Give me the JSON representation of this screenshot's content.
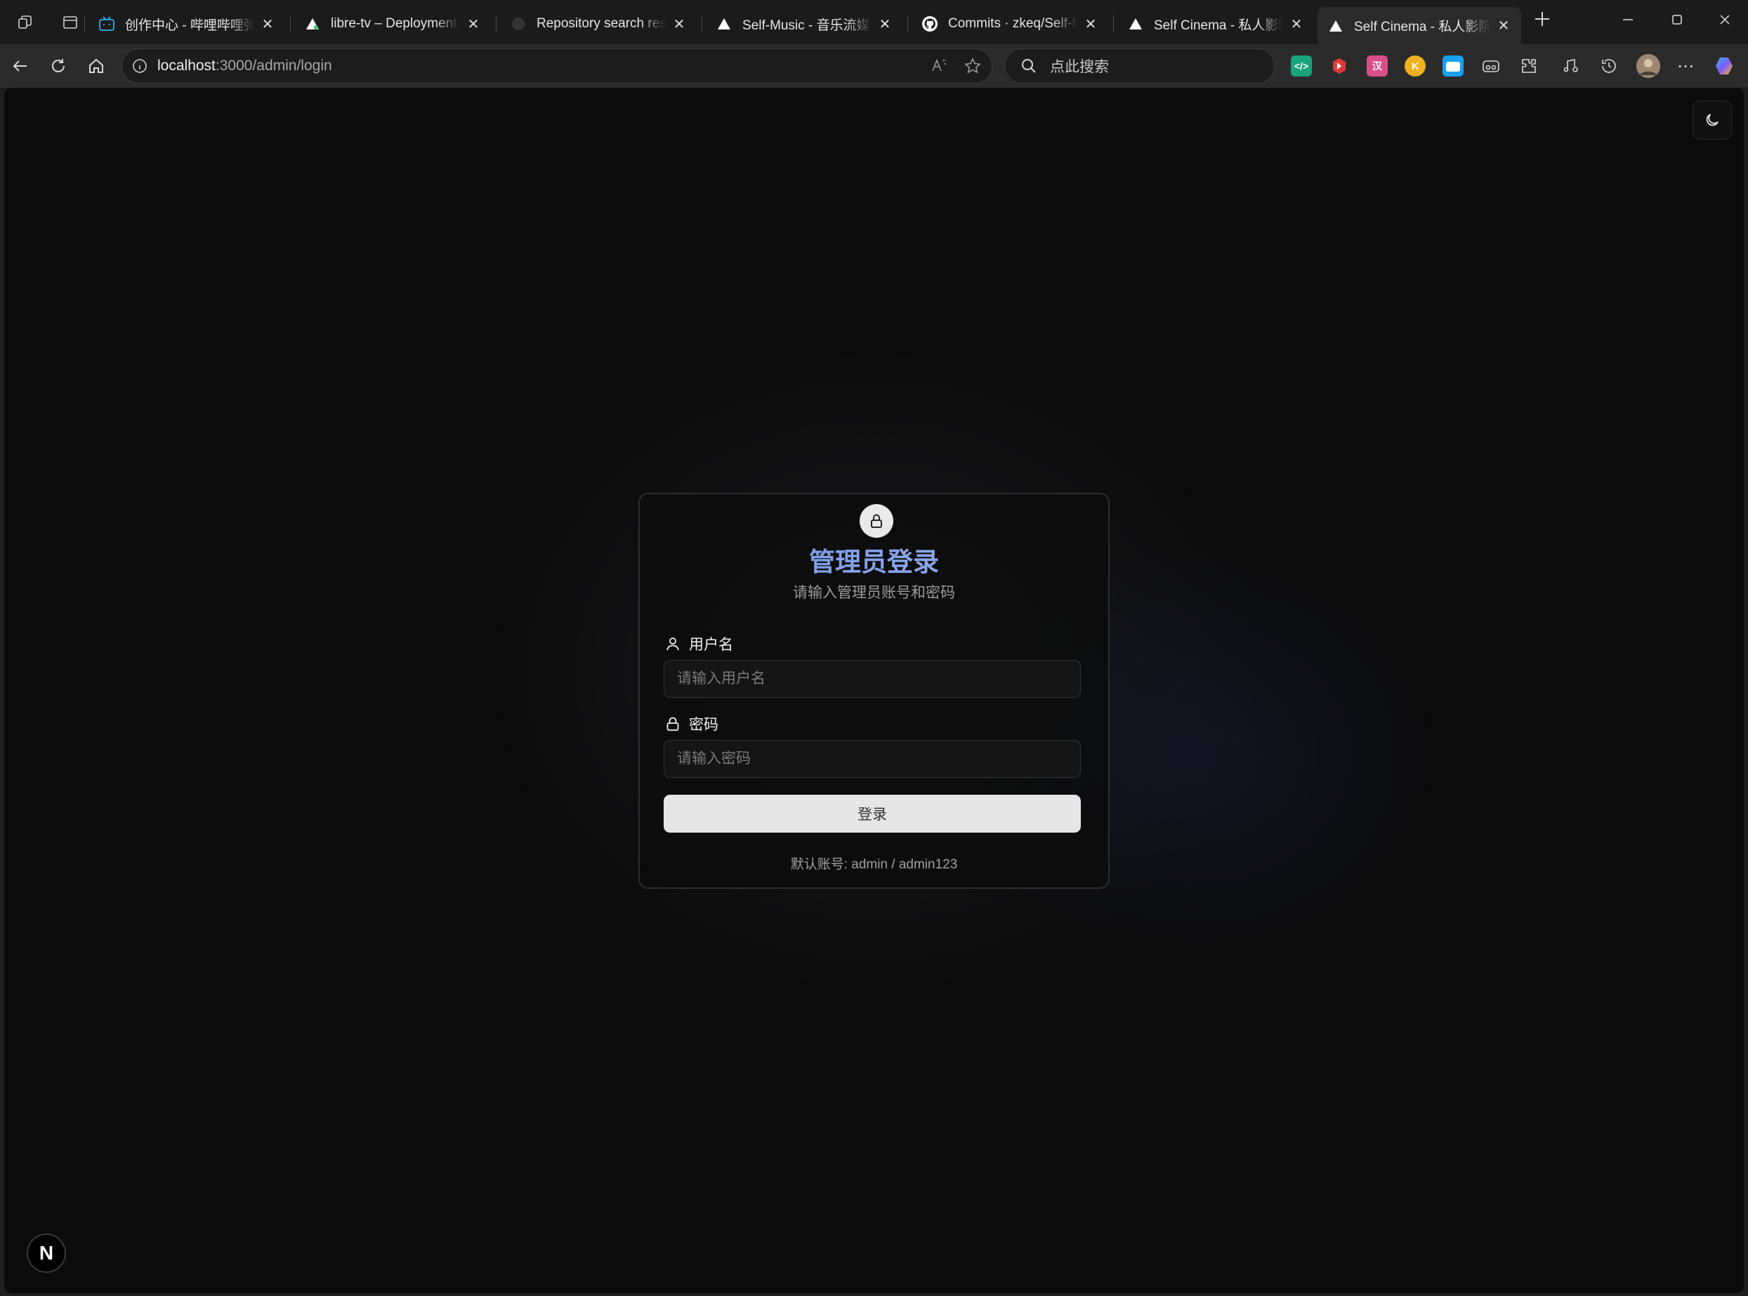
{
  "browser": {
    "tabs": [
      {
        "title": "创作中心 - 哔哩哔哩弹幕",
        "favicon": "bilibili-icon"
      },
      {
        "title": "libre-tv – Deployment Ov",
        "favicon": "vercel-icon"
      },
      {
        "title": "Repository search results",
        "favicon": "github-icon"
      },
      {
        "title": "Self-Music - 音乐流媒体",
        "favicon": "vercel-icon"
      },
      {
        "title": "Commits · zkeq/Self-Mus",
        "favicon": "github-icon"
      },
      {
        "title": "Self Cinema - 私人影院系",
        "favicon": "vercel-icon"
      },
      {
        "title": "Self Cinema - 私人影院系",
        "favicon": "vercel-icon",
        "active": true
      }
    ],
    "address": {
      "host": "localhost",
      "path": ":3000/admin/login"
    },
    "search_placeholder": "点此搜索"
  },
  "login": {
    "title": "管理员登录",
    "subtitle": "请输入管理员账号和密码",
    "username_label": "用户名",
    "username_placeholder": "请输入用户名",
    "password_label": "密码",
    "password_placeholder": "请输入密码",
    "submit_label": "登录",
    "hint": "默认账号: admin / admin123"
  },
  "colors": {
    "page_background": "#0b0b0b",
    "title_accent": "#7c9ce0",
    "button_background": "#e6e6e6"
  },
  "badge": {
    "label": "N"
  }
}
